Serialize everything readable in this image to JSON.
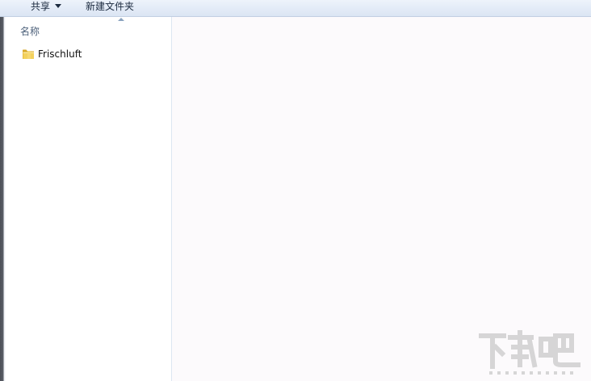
{
  "toolbar": {
    "share_label": "共享",
    "new_folder_label": "新建文件夹"
  },
  "list": {
    "column_header": "名称",
    "items": [
      {
        "name": "Frischluft",
        "icon": "folder-icon"
      }
    ]
  },
  "colors": {
    "toolbar_bg": "#e3ebf7",
    "content_bg": "#fcfafc",
    "folder_yellow": "#e8c24a"
  }
}
